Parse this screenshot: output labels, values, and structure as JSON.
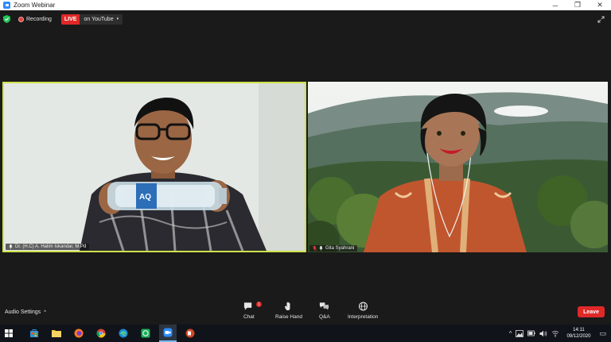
{
  "window": {
    "title": "Zoom Webinar",
    "minimize": "─",
    "restore": "❐",
    "close": "✕"
  },
  "status": {
    "recording_label": "Recording",
    "live_label": "LIVE",
    "live_target": "on YouTube",
    "caret": "▾"
  },
  "videos": {
    "speaker_name": "Dr. (H.C) A. Halim Iskandar, M.Pd",
    "other_name": "Gita Syahrani"
  },
  "toolbar": {
    "audio_settings": "Audio Settings",
    "audio_caret": "^",
    "chat_label": "Chat",
    "chat_badge": "1",
    "raise_hand_label": "Raise Hand",
    "qa_label": "Q&A",
    "interpretation_label": "Interpretation",
    "leave_label": "Leave"
  },
  "taskbar": {
    "time": "14:11",
    "date": "09/12/2020",
    "tray_chevron": "^",
    "notification": "▭"
  },
  "colors": {
    "speaker_border": "#cfe34a",
    "live": "#e02828",
    "leave": "#e02828",
    "zoom_blue": "#2d8cff"
  }
}
